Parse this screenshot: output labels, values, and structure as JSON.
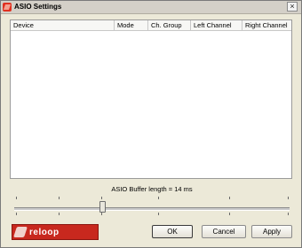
{
  "window": {
    "title": "ASIO Settings",
    "close_glyph": "×",
    "title_icon": "reloop-app-icon",
    "close_icon": "close-icon"
  },
  "device_list": {
    "columns": [
      "Device",
      "Mode",
      "Ch. Group",
      "Left Channel",
      "Right Channel"
    ],
    "rows": []
  },
  "buffer": {
    "label": "ASIO Buffer length = 14 ms",
    "value_fraction": 0.32
  },
  "logo": {
    "text": "reloop",
    "brand_color": "#c8281e"
  },
  "buttons": {
    "ok": "OK",
    "cancel": "Cancel",
    "apply": "Apply"
  }
}
